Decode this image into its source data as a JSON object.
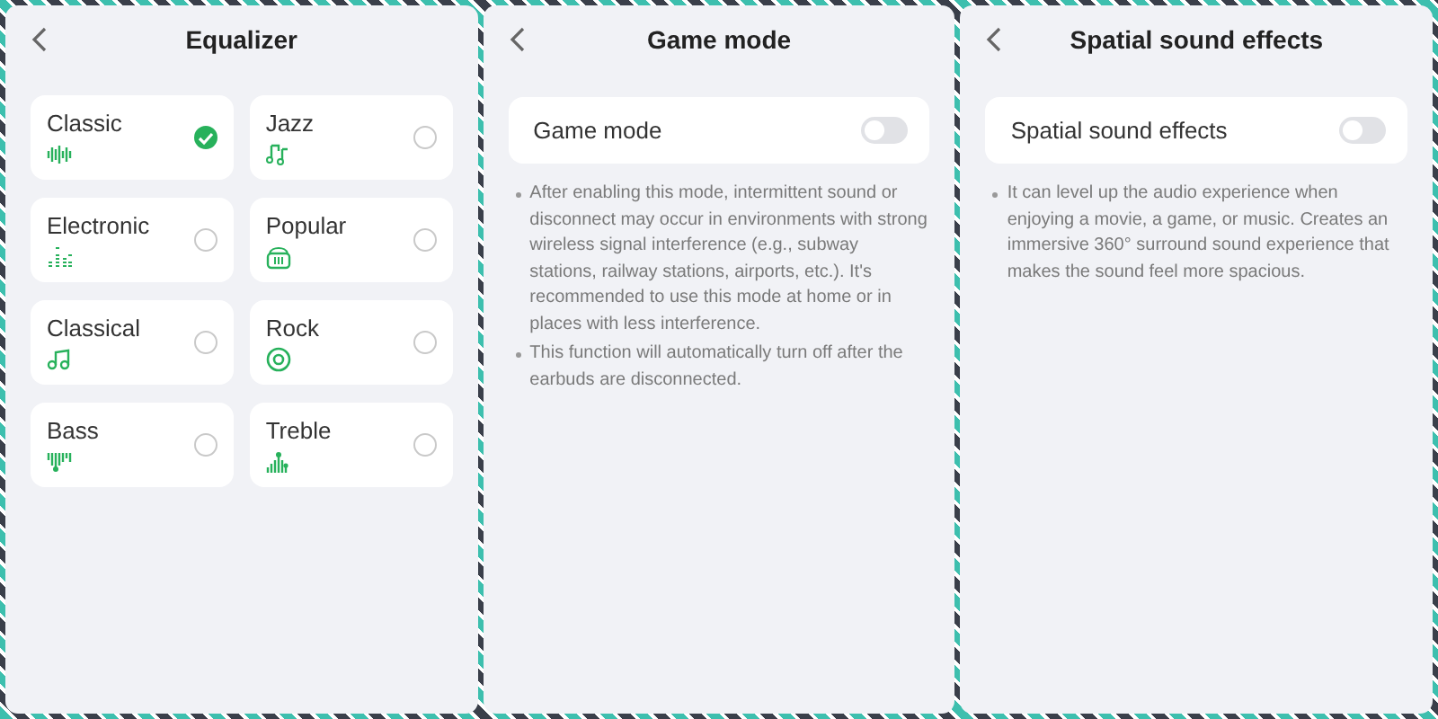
{
  "screens": [
    {
      "kind": "equalizer",
      "title": "Equalizer",
      "presets": [
        {
          "label": "Classic",
          "selected": true
        },
        {
          "label": "Jazz",
          "selected": false
        },
        {
          "label": "Electronic",
          "selected": false
        },
        {
          "label": "Popular",
          "selected": false
        },
        {
          "label": "Classical",
          "selected": false
        },
        {
          "label": "Rock",
          "selected": false
        },
        {
          "label": "Bass",
          "selected": false
        },
        {
          "label": "Treble",
          "selected": false
        }
      ]
    },
    {
      "kind": "toggle",
      "title": "Game mode",
      "setting": {
        "label": "Game mode",
        "on": false
      },
      "notes": [
        "After enabling this mode, intermittent sound or disconnect may occur in environments with strong wireless signal interference (e.g., subway stations, railway stations, airports, etc.). It's recommended to use this mode at home or in places with less interference.",
        "This function will automatically turn off after the earbuds are disconnected."
      ]
    },
    {
      "kind": "toggle",
      "title": "Spatial sound effects",
      "setting": {
        "label": "Spatial sound effects",
        "on": false
      },
      "notes": [
        "It can level up the audio experience when enjoying a movie, a game, or music. Creates an immersive 360° surround sound experience that makes the sound feel more spacious."
      ]
    }
  ]
}
